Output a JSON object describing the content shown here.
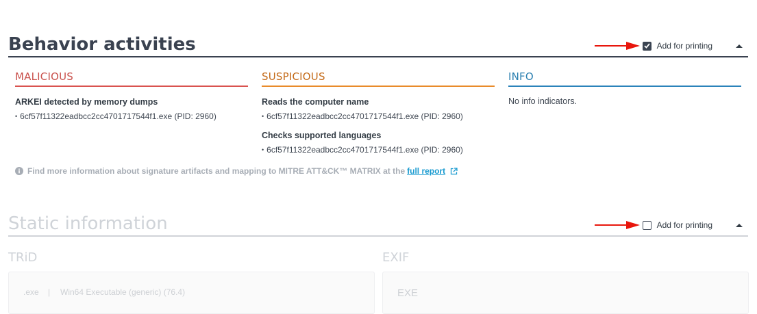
{
  "behavior": {
    "title": "Behavior activities",
    "print_label": "Add for printing",
    "print_checked": true,
    "columns": {
      "malicious": {
        "title": "MALICIOUS",
        "indicators": [
          {
            "title": "ARKEI detected by memory dumps",
            "process": "6cf57f11322eadbcc2cc4701717544f1.exe (PID: 2960)"
          }
        ]
      },
      "suspicious": {
        "title": "SUSPICIOUS",
        "indicators": [
          {
            "title": "Reads the computer name",
            "process": "6cf57f11322eadbcc2cc4701717544f1.exe (PID: 2960)"
          },
          {
            "title": "Checks supported languages",
            "process": "6cf57f11322eadbcc2cc4701717544f1.exe (PID: 2960)"
          }
        ]
      },
      "info": {
        "title": "INFO",
        "empty_text": "No info indicators."
      }
    },
    "note": {
      "text": "Find more information about signature artifacts and mapping to MITRE ATT&CK™ MATRIX at the",
      "link": "full report"
    }
  },
  "static": {
    "title": "Static information",
    "print_label": "Add for printing",
    "print_checked": false,
    "trid": {
      "title": "TRiD",
      "row": {
        "ext": ".exe",
        "sep": "|",
        "desc": "Win64 Executable (generic) (76.4)"
      }
    },
    "exif": {
      "title": "EXIF",
      "value": "EXE"
    }
  },
  "colors": {
    "malicious": "#d9534f",
    "suspicious": "#e98b2a",
    "info": "#2b83ba",
    "link": "#1a9bd0",
    "arrow": "#e8160c"
  },
  "icons": {
    "collapse": "chevron-up-icon",
    "note": "info-circle-icon",
    "external": "external-link-icon",
    "arrow": "red-arrow-annotation"
  }
}
